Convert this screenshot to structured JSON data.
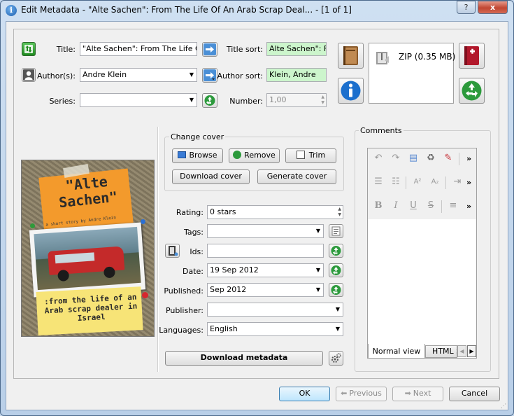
{
  "window": {
    "title": "Edit Metadata - \"Alte Sachen\": From The Life Of An Arab Scrap Deal... -   [1 of 1]",
    "help_glyph": "?",
    "minimize_glyph": "–",
    "maximize_glyph": "□",
    "close_glyph": "x"
  },
  "fields": {
    "title_label": "Title:",
    "title_value": "\"Alte Sachen\": From The Life Of An",
    "title_sort_label": "Title sort:",
    "title_sort_value": "Alte Sachen\": Fro",
    "authors_label": "Author(s):",
    "authors_value": "Andre Klein",
    "author_sort_label": "Author sort:",
    "author_sort_value": "Klein, Andre",
    "series_label": "Series:",
    "series_value": "",
    "number_label": "Number:",
    "number_value": "1,00"
  },
  "formats": {
    "item_label": "ZIP (0.35 MB)"
  },
  "cover": {
    "group_label": "Change cover",
    "browse": "Browse",
    "remove": "Remove",
    "trim": "Trim",
    "download_cover": "Download cover",
    "generate_cover": "Generate cover",
    "image_title": "\"Alte Sachen\"",
    "image_byline": "a short story by Andre Klein",
    "image_subtitle": ":from the life of an Arab scrap dealer in Israel"
  },
  "meta": {
    "rating_label": "Rating:",
    "rating_value": "0 stars",
    "tags_label": "Tags:",
    "tags_value": "",
    "ids_label": "Ids:",
    "ids_value": "",
    "date_label": "Date:",
    "date_value": "19 Sep 2012",
    "published_label": "Published:",
    "published_value": "Sep 2012",
    "publisher_label": "Publisher:",
    "publisher_value": "",
    "languages_label": "Languages:",
    "languages_value": "English",
    "download_metadata": "Download metadata"
  },
  "comments": {
    "label": "Comments",
    "tab_normal": "Normal view",
    "tab_html": "HTML S",
    "toolbar_more": "»"
  },
  "footer": {
    "ok": "OK",
    "previous": "Previous",
    "next": "Next",
    "cancel": "Cancel"
  },
  "colors": {
    "sort_field_bg": "#ccf5cc",
    "cover_orange": "#f39a2c",
    "note_yellow": "#f7e477",
    "close_red": "#c14632"
  }
}
